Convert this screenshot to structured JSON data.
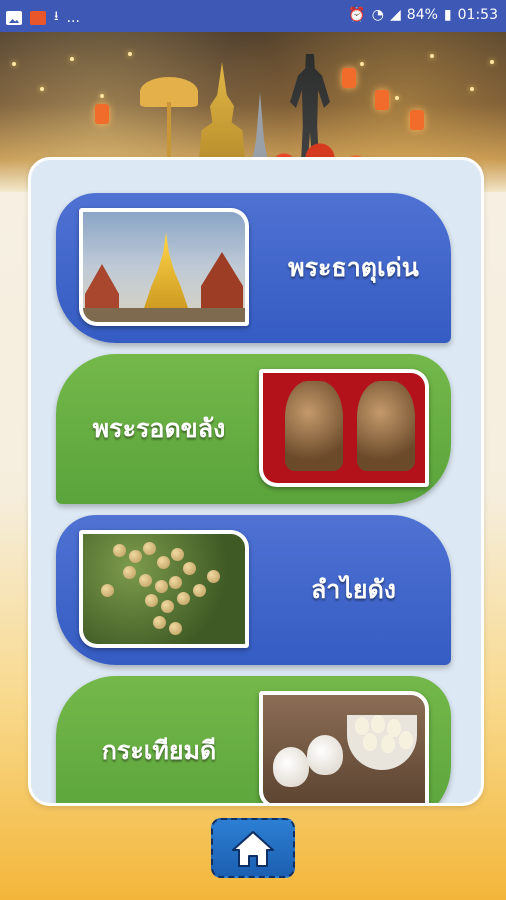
{
  "status_bar": {
    "notification_icons": [
      "gallery-icon",
      "app-icon",
      "download-done-icon"
    ],
    "more_indicator": "...",
    "battery": "84%",
    "time": "01:53"
  },
  "menu": {
    "items": [
      {
        "label": "พระธาตุเด่น",
        "color": "blue",
        "image": "temple-photo"
      },
      {
        "label": "พระรอดขลัง",
        "color": "green",
        "image": "amulet-photo"
      },
      {
        "label": "ลำไยดัง",
        "color": "blue",
        "image": "longan-photo"
      },
      {
        "label": "กระเทียมดี",
        "color": "green",
        "image": "garlic-photo"
      }
    ]
  },
  "colors": {
    "status_bar": "#3d58b5",
    "card_blue": "#355cc3",
    "card_green": "#5aa43b",
    "panel": "#dce8f3",
    "home_button": "#1c5fb1"
  },
  "footer": {
    "home_icon": "home-icon"
  }
}
